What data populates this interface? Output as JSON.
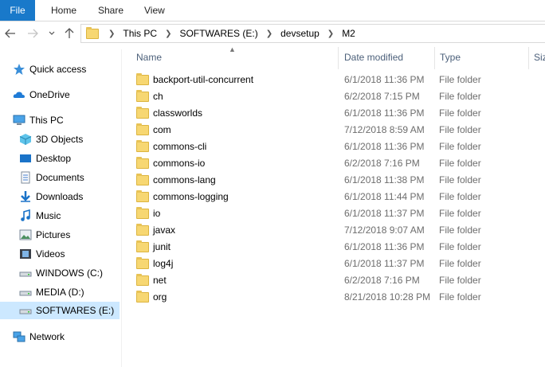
{
  "ribbon": {
    "file_label": "File",
    "tabs": [
      "Home",
      "Share",
      "View"
    ]
  },
  "address": {
    "crumbs": [
      "This PC",
      "SOFTWARES (E:)",
      "devsetup",
      "M2"
    ]
  },
  "nav_pane": {
    "items": [
      {
        "label": "Quick access",
        "icon": "star-icon"
      },
      {
        "label": "OneDrive",
        "icon": "cloud-icon"
      },
      {
        "label": "This PC",
        "icon": "computer-icon"
      },
      {
        "label": "3D Objects",
        "icon": "cube-icon"
      },
      {
        "label": "Desktop",
        "icon": "desktop-icon"
      },
      {
        "label": "Documents",
        "icon": "document-icon"
      },
      {
        "label": "Downloads",
        "icon": "download-icon"
      },
      {
        "label": "Music",
        "icon": "music-icon"
      },
      {
        "label": "Pictures",
        "icon": "picture-icon"
      },
      {
        "label": "Videos",
        "icon": "video-icon"
      },
      {
        "label": "WINDOWS (C:)",
        "icon": "drive-icon"
      },
      {
        "label": "MEDIA (D:)",
        "icon": "drive-icon"
      },
      {
        "label": "SOFTWARES (E:)",
        "icon": "drive-icon",
        "selected": true
      },
      {
        "label": "Network",
        "icon": "network-icon"
      }
    ]
  },
  "columns": {
    "name": "Name",
    "date": "Date modified",
    "type": "Type",
    "size": "Siz"
  },
  "files": [
    {
      "name": "backport-util-concurrent",
      "date": "6/1/2018 11:36 PM",
      "type": "File folder"
    },
    {
      "name": "ch",
      "date": "6/2/2018 7:15 PM",
      "type": "File folder"
    },
    {
      "name": "classworlds",
      "date": "6/1/2018 11:36 PM",
      "type": "File folder"
    },
    {
      "name": "com",
      "date": "7/12/2018 8:59 AM",
      "type": "File folder"
    },
    {
      "name": "commons-cli",
      "date": "6/1/2018 11:36 PM",
      "type": "File folder"
    },
    {
      "name": "commons-io",
      "date": "6/2/2018 7:16 PM",
      "type": "File folder"
    },
    {
      "name": "commons-lang",
      "date": "6/1/2018 11:38 PM",
      "type": "File folder"
    },
    {
      "name": "commons-logging",
      "date": "6/1/2018 11:44 PM",
      "type": "File folder"
    },
    {
      "name": "io",
      "date": "6/1/2018 11:37 PM",
      "type": "File folder"
    },
    {
      "name": "javax",
      "date": "7/12/2018 9:07 AM",
      "type": "File folder"
    },
    {
      "name": "junit",
      "date": "6/1/2018 11:36 PM",
      "type": "File folder"
    },
    {
      "name": "log4j",
      "date": "6/1/2018 11:37 PM",
      "type": "File folder"
    },
    {
      "name": "net",
      "date": "6/2/2018 7:16 PM",
      "type": "File folder"
    },
    {
      "name": "org",
      "date": "8/21/2018 10:28 PM",
      "type": "File folder"
    }
  ]
}
